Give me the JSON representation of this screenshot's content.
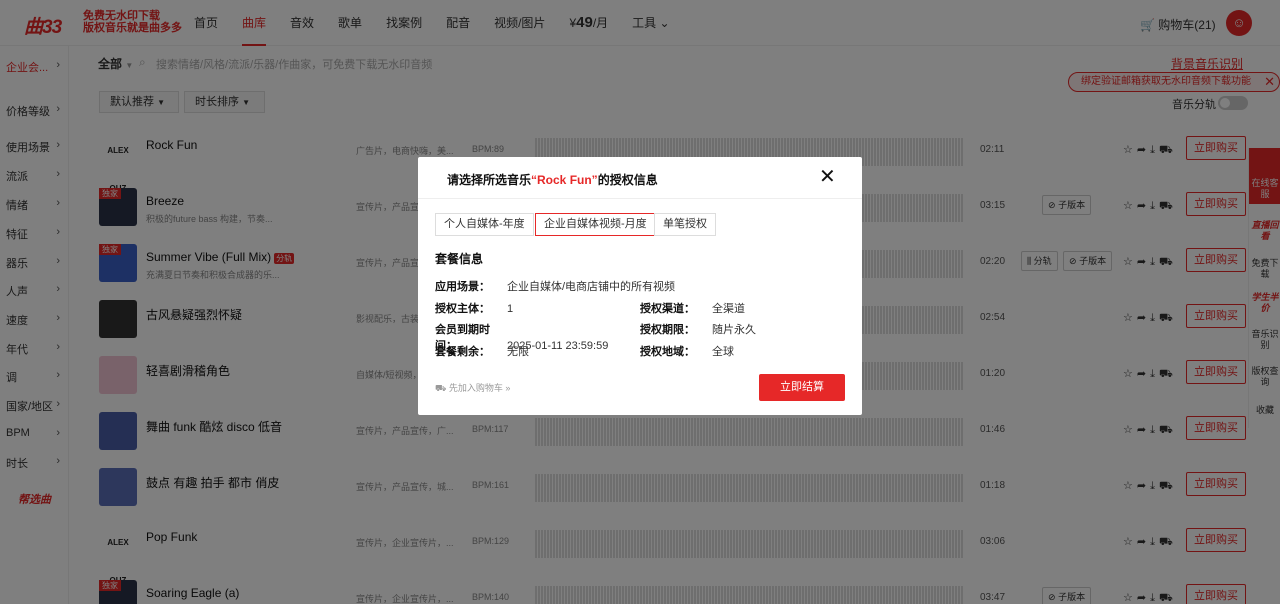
{
  "brand": {
    "logo": "曲33",
    "slogan_line1": "免费无水印下载",
    "slogan_line2": "版权音乐就是曲多多"
  },
  "nav": {
    "links": [
      "首页",
      "曲库",
      "音效",
      "歌单",
      "找案例",
      "配音",
      "视频/图片"
    ],
    "price_symbol": "¥",
    "price": "49",
    "price_unit": "/月",
    "tools": "工具",
    "cart": "购物车(21)"
  },
  "sidebar": {
    "items": [
      "企业会...",
      "价格等级",
      "使用场景",
      "流派",
      "情绪",
      "特征",
      "器乐",
      "人声",
      "速度",
      "年代",
      "调",
      "国家/地区",
      "BPM",
      "时长"
    ],
    "help": "帮选曲"
  },
  "filter": {
    "all": "全部",
    "search_placeholder": "搜索情绪/风格/流派/乐器/作曲家，可免费下载无水印音频",
    "sort1": "默认推荐",
    "sort2": "时长排序"
  },
  "bg_music": "背景音乐识别",
  "notice": "绑定验证邮箱获取无水印音频下载功能",
  "split_label": "音乐分轨",
  "tracks": [
    {
      "title": "Rock Fun",
      "desc": "",
      "tags": "广告片，电商快嗨，美...",
      "bpm": "BPM:89",
      "dur": "02:11",
      "thumb": "ALEX QUZ",
      "excl": ""
    },
    {
      "title": "Breeze",
      "desc": "积极的future bass 构建，节奏...",
      "tags": "宣传片，产品宣",
      "bpm": "",
      "dur": "03:15",
      "thumb": "",
      "excl": "独家"
    },
    {
      "title": "Summer Vibe (Full Mix)",
      "badge": "分轨",
      "desc": "充满夏日节奏和积极合成器的乐...",
      "tags": "宣传片，产品宣",
      "bpm": "",
      "dur": "02:20",
      "thumb": "",
      "excl": "独家"
    },
    {
      "title": "古风悬疑强烈怀疑",
      "desc": "",
      "tags": "影视配乐，古装",
      "bpm": "",
      "dur": "02:54",
      "thumb": "",
      "excl": ""
    },
    {
      "title": "轻喜剧滑稽角色",
      "desc": "",
      "tags": "自媒体/短视频，",
      "bpm": "",
      "dur": "01:20",
      "thumb": "",
      "excl": ""
    },
    {
      "title": "舞曲 funk 酷炫 disco 低音",
      "desc": "",
      "tags": "宣传片，产品宣传，广...",
      "bpm": "BPM:117",
      "dur": "01:46",
      "thumb": "",
      "excl": ""
    },
    {
      "title": "鼓点 有趣 拍手 都市 俏皮",
      "desc": "",
      "tags": "宣传片，产品宣传，城...",
      "bpm": "BPM:161",
      "dur": "01:18",
      "thumb": "",
      "excl": ""
    },
    {
      "title": "Pop Funk",
      "desc": "",
      "tags": "宣传片，企业宣传片，...",
      "bpm": "BPM:129",
      "dur": "03:06",
      "thumb": "ALEX QUZ",
      "excl": ""
    },
    {
      "title": "Soaring Eagle (a)",
      "desc": "",
      "tags": "宣传片，企业宣传片，...",
      "bpm": "BPM:140",
      "dur": "03:47",
      "thumb": "",
      "excl": "独家"
    }
  ],
  "labels": {
    "sub_version": "子版本",
    "split": "分轨",
    "buy": "立即购买"
  },
  "rightbar": {
    "online": "在线客服",
    "live": "直播回看",
    "free": "免费下载",
    "student": "学生半价",
    "recognize": "音乐识别",
    "copyright": "版权查询",
    "collect": "收藏"
  },
  "modal": {
    "title_prefix": "请选择所选音乐",
    "song": "“Rock Fun”",
    "title_suffix": "的授权信息",
    "tabs": [
      "个人自媒体-年度",
      "企业自媒体视频-月度",
      "单笔授权"
    ],
    "package_heading": "套餐信息",
    "scene_k": "应用场景：",
    "scene_v": "企业自媒体/电商店铺中的所有视频",
    "subject_k": "授权主体：",
    "subject_v": "1",
    "channel_k": "授权渠道：",
    "channel_v": "全渠道",
    "expire_k": "会员到期时间：",
    "expire_v": "2025-01-11 23:59:59",
    "period_k": "授权期限：",
    "period_v": "随片永久",
    "remain_k": "套餐剩余：",
    "remain_v": "无限",
    "region_k": "授权地域：",
    "region_v": "全球",
    "add_cart": "先加入购物车",
    "checkout": "立即结算"
  },
  "colors": {
    "accent": "#e62828"
  }
}
